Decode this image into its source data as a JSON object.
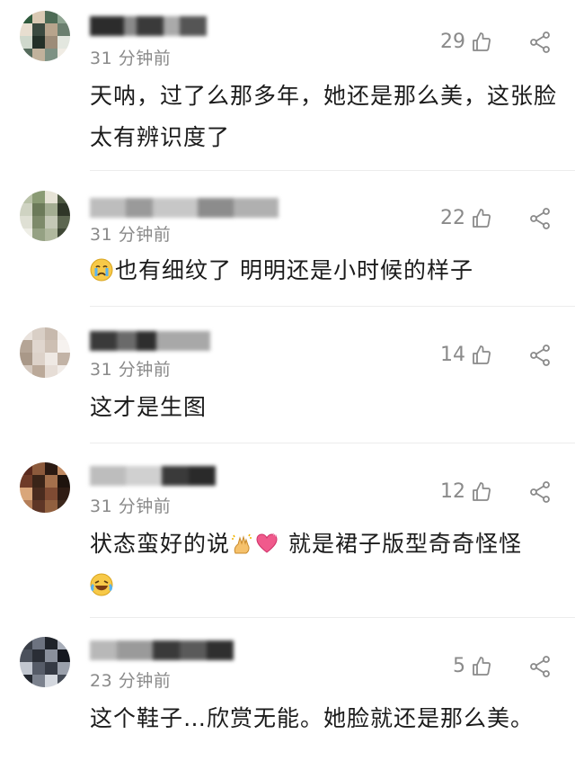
{
  "comments": [
    {
      "time": "31 分钟前",
      "likes": "29",
      "text": "天呐，过了么那多年，她还是那么美，这张脸太有辨识度了",
      "avatar_colors": [
        "#2f5a3d",
        "#d9c9b3",
        "#4d6b55",
        "#8fa592",
        "#e8ded0",
        "#3b4a40",
        "#b7a48c",
        "#6b7f6f",
        "#cfd8cc",
        "#233028",
        "#9c8c78",
        "#e3e7df",
        "#556b5c",
        "#c1b29c",
        "#7e9284",
        "#f0ece4"
      ]
    },
    {
      "time": "31 分钟前",
      "likes": "22",
      "text": "也有细纹了 明明还是小时候的样子",
      "emoji_lead": "crying-face-emoji",
      "avatar_colors": [
        "#b9c2a8",
        "#8a9b74",
        "#e6e3d6",
        "#4f5a43",
        "#cfd3c2",
        "#6b7a59",
        "#a3ad92",
        "#2f3628",
        "#dfe0d4",
        "#7d8a6a",
        "#c4c8b6",
        "#5c6650",
        "#eeeee6",
        "#95a183",
        "#b0b89e",
        "#3f4836"
      ]
    },
    {
      "time": "31 分钟前",
      "likes": "14",
      "text": "这才是生图",
      "avatar_colors": [
        "#e9e2dc",
        "#d9cfc6",
        "#c7b9ad",
        "#f3eeea",
        "#b5a596",
        "#e0d6ce",
        "#cdbfb3",
        "#f6f2ef",
        "#a99888",
        "#ddd2c9",
        "#efe9e4",
        "#c2b3a6",
        "#d4c8be",
        "#bba999",
        "#e6ddd6",
        "#f1ece8"
      ]
    },
    {
      "time": "31 分钟前",
      "likes": "12",
      "text_part1": "状态蛮好的说",
      "emoji_mid": [
        "sparkle-hands-emoji",
        "heart-emoji"
      ],
      "text_part2": " 就是裙子版型奇奇怪怪",
      "emoji_tail": "laughing-tears-emoji",
      "avatar_colors": [
        "#5a2a1e",
        "#8c5a3c",
        "#2b1a12",
        "#c08a62",
        "#6e3b28",
        "#3a2418",
        "#a4704c",
        "#1e130d",
        "#d9a67a",
        "#4a2c1f",
        "#7f4b33",
        "#2f1c14",
        "#b47e58",
        "#5e3626",
        "#91603f",
        "#3c271b"
      ]
    },
    {
      "time": "23 分钟前",
      "likes": "5",
      "text": "这个鞋子…欣赏无能。她脸就还是那么美。",
      "avatar_colors": [
        "#3a3f48",
        "#6d7380",
        "#1f232a",
        "#a7adb8",
        "#4b515c",
        "#2a2e36",
        "#8a909c",
        "#151820",
        "#c2c7d0",
        "#565c68",
        "#353a44",
        "#9aa0ab",
        "#242830",
        "#7b818d",
        "#d3d7de",
        "#454b56"
      ]
    }
  ],
  "icons": {
    "like": "thumbs-up-outline-icon",
    "share": "share-icon"
  },
  "colors": {
    "text": "#1b1b1b",
    "meta": "#8a8a8a",
    "divider": "#ececec",
    "background": "#ffffff"
  }
}
